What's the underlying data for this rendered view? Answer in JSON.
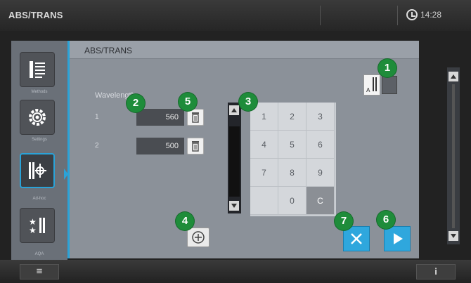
{
  "topbar": {
    "title": "ABS/TRANS",
    "time": "14:28"
  },
  "sidebar": {
    "items": [
      {
        "icon": "methods-list-icon",
        "label": "Methods"
      },
      {
        "icon": "settings-gear-icon",
        "label": "Settings"
      },
      {
        "icon": "adhoc-measure-icon",
        "label": "Ad-hoc"
      },
      {
        "icon": "qa-stars-icon",
        "label": "AQA"
      }
    ]
  },
  "panel": {
    "title": "ABS/TRANS"
  },
  "wavelengths": {
    "label": "Wavelength",
    "rows": [
      {
        "num": "1",
        "value": "560"
      },
      {
        "num": "2",
        "value": "500"
      }
    ]
  },
  "keypad": {
    "keys": [
      "1",
      "2",
      "3",
      "4",
      "5",
      "6",
      "7",
      "8",
      "9",
      "",
      "0",
      "C"
    ]
  },
  "bottombar": {
    "menu_glyph": "≡",
    "info_glyph": "i"
  },
  "callouts": [
    "1",
    "2",
    "3",
    "4",
    "5",
    "6",
    "7"
  ],
  "colors": {
    "accent": "#2aa3d8",
    "callout": "#1e8c3a"
  }
}
